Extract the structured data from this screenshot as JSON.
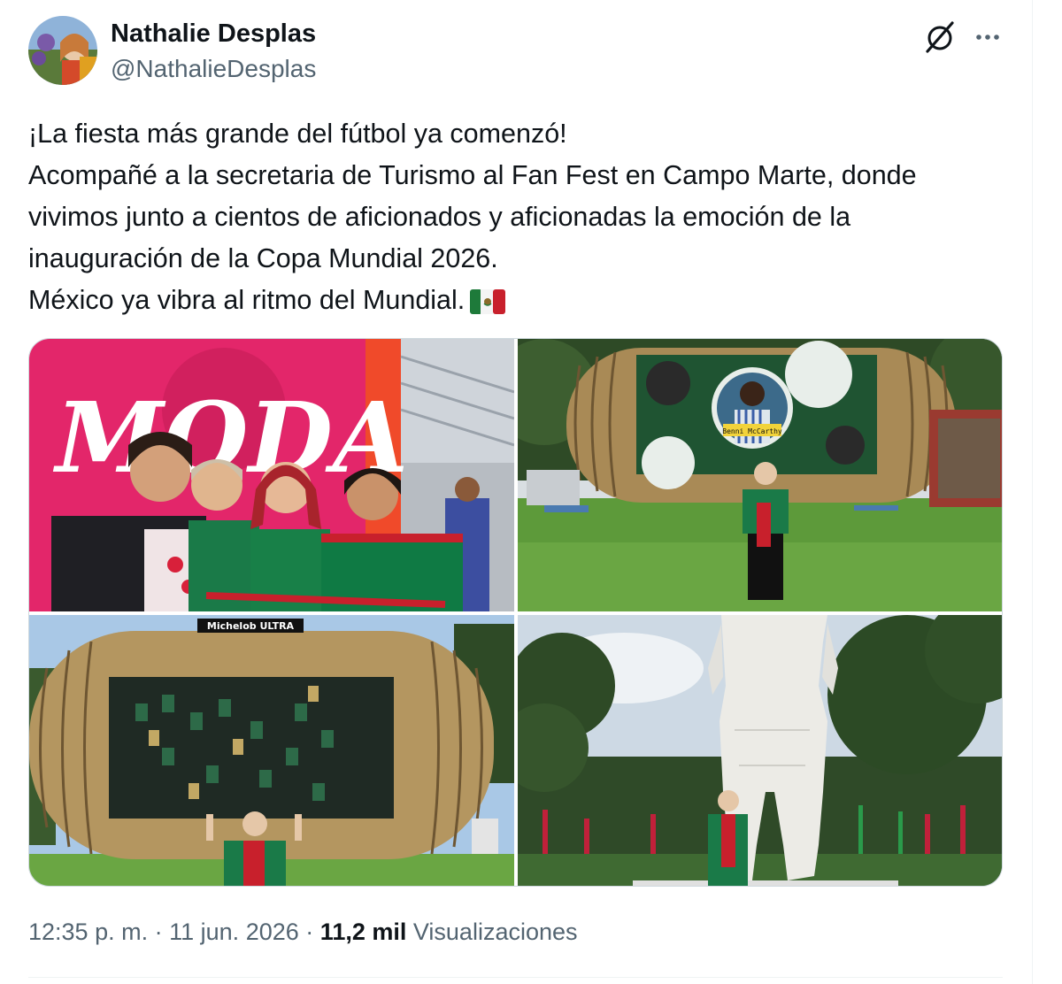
{
  "author": {
    "name": "Nathalie Desplas",
    "handle": "@NathalieDesplas"
  },
  "icons": {
    "grok": "grok-icon",
    "more": "more-icon",
    "flag": "mexico-flag-emoji"
  },
  "tweet": {
    "lines": [
      "¡La fiesta más grande del fútbol ya comenzó!",
      "Acompañé a la secretaria de Turismo al Fan Fest en Campo Marte, donde",
      "vivimos junto a cientos de aficionados y aficionadas la emoción de la",
      "inauguración de la Copa Mundial 2026.",
      "México ya vibra al ritmo del Mundial."
    ]
  },
  "media": {
    "photo1": {
      "sign_text": "MODA"
    },
    "photo2": {
      "screen_caption": "Benni McCarthy"
    },
    "photo3": {
      "banner_text": "Michelob ULTRA"
    }
  },
  "meta": {
    "time": "12:35 p. m.",
    "separator": "·",
    "date": "11 jun. 2026",
    "views_count": "11,2 mil",
    "views_label": "Visualizaciones"
  },
  "colors": {
    "text_primary": "#0f1419",
    "text_secondary": "#536471",
    "border": "#cfd9de"
  }
}
